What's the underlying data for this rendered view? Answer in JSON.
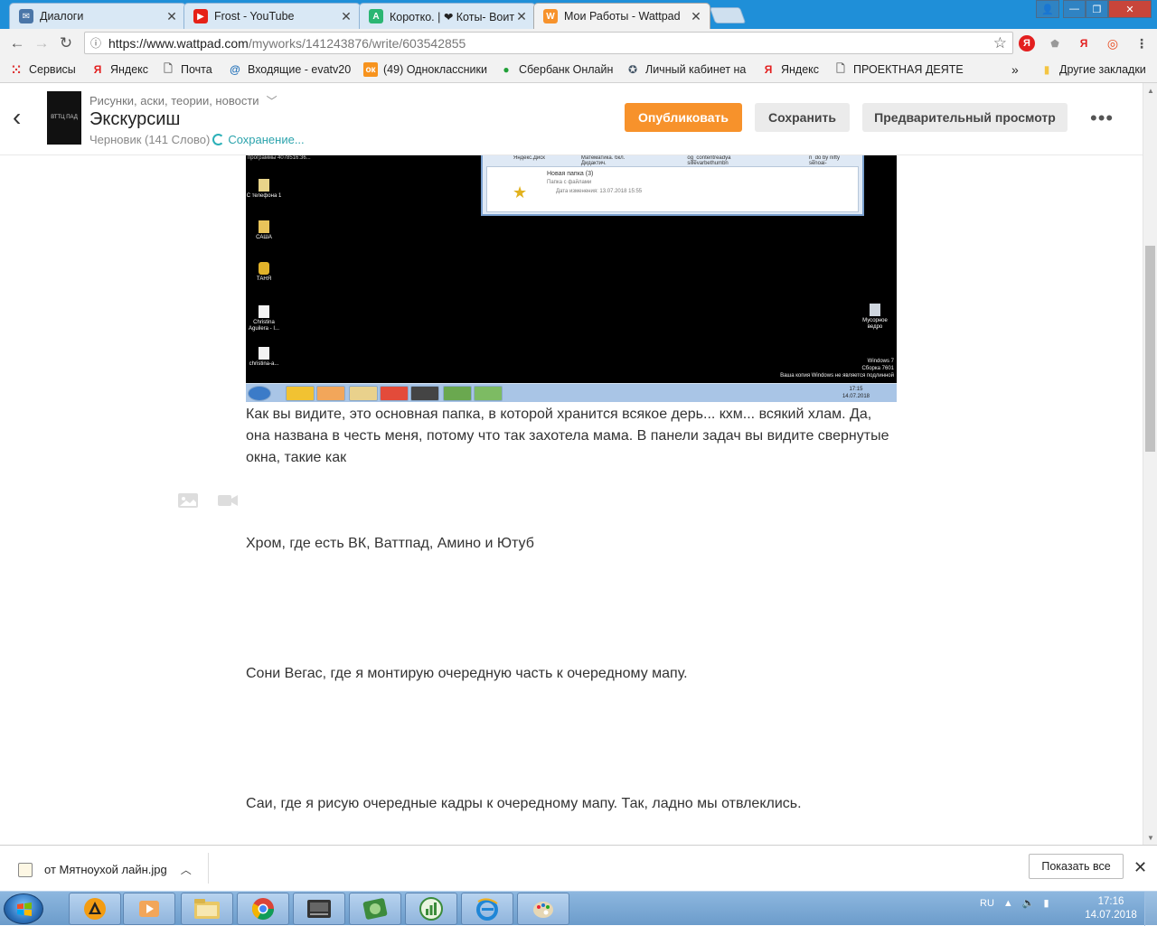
{
  "browser": {
    "tabs": [
      {
        "label": "Диалоги",
        "icon": "vk-icon",
        "color": "#4a76a8"
      },
      {
        "label": "Frost - YouTube",
        "icon": "youtube-icon",
        "color": "#e62117"
      },
      {
        "label": "Коротко. | ❤ Коты- Воит",
        "icon": "amino-icon",
        "color": "#2bb673"
      },
      {
        "label": "Мои Работы - Wattpad",
        "icon": "wattpad-icon",
        "color": "#f7922b"
      }
    ],
    "url_host": "https://www.wattpad.com",
    "url_path": "/myworks/141243876/write/603542855",
    "bookmarks": [
      {
        "label": "Сервисы",
        "icon": "apps-icon"
      },
      {
        "label": "Яндекс",
        "icon": "yandex-icon"
      },
      {
        "label": "Почта",
        "icon": "page-icon"
      },
      {
        "label": "Входящие - evatv20",
        "icon": "mail-icon"
      },
      {
        "label": "(49) Одноклассники",
        "icon": "ok-icon"
      },
      {
        "label": "Сбербанк Онлайн",
        "icon": "sber-icon"
      },
      {
        "label": "Личный кабинет на",
        "icon": "gov-icon"
      },
      {
        "label": "Яндекс",
        "icon": "yandex-icon"
      },
      {
        "label": "ПРОЕКТНАЯ ДЕЯТЕ",
        "icon": "page-icon"
      }
    ],
    "bookmarks_overflow": "»",
    "other_bookmarks": "Другие закладки"
  },
  "editor": {
    "story_name": "Рисунки, аски, теории, новости",
    "part_title": "Экскурсиш",
    "cover_text": "ВТТЦ ПАД",
    "status_draft": "Черновик (141 Слово)",
    "status_saving": "Сохранение...",
    "publish_label": "Опубликовать",
    "save_label": "Сохранить",
    "preview_label": "Предварительный просмотр",
    "more_label": "•••"
  },
  "embedded_shot": {
    "top_text": "программы    4078516:36...",
    "explorer_header": [
      "Яндекс.Диск",
      "Математика. бкл. Дидактич.",
      "og_contentreadya sillevarbethumbn",
      "n_do by nifty senoai-"
    ],
    "folder_name": "Новая папка (3)",
    "folder_meta": "Папка с файлами",
    "folder_date": "Дата изменения: 13.07.2018 15:55",
    "desktop_icons": [
      "С телефона 1",
      "САША",
      "ТАНЯ",
      "Christina Aguilera - I...",
      "christina-a..."
    ],
    "recycle_bin": "Мусорное ведро",
    "win_notice": [
      "Windows 7",
      "Сборка 7601",
      "Ваша копия Windows не является подлинной"
    ],
    "clock": [
      "17:15",
      "14.07.2018"
    ]
  },
  "body": {
    "p1": "Как вы видите, это основная папка, в которой хранится всякое дерь... кхм... всякий хлам. Да, она названа в честь меня, потому что так захотела мама. В панели задач вы видите свернутые окна, такие как",
    "p2": "Хром, где есть ВК, Ваттпад, Амино и Ютуб",
    "p3": "Сони Вегас, где я монтирую очередную часть к очередному мапу.",
    "p4": "Саи, где я рисую очередные кадры к очередному мапу. Так, ладно мы отвлеклись."
  },
  "downloads": {
    "file": "от Мятноухой лайн.jpg",
    "show_all": "Показать все"
  },
  "taskbar": {
    "lang": "RU",
    "time": "17:16",
    "date": "14.07.2018"
  }
}
